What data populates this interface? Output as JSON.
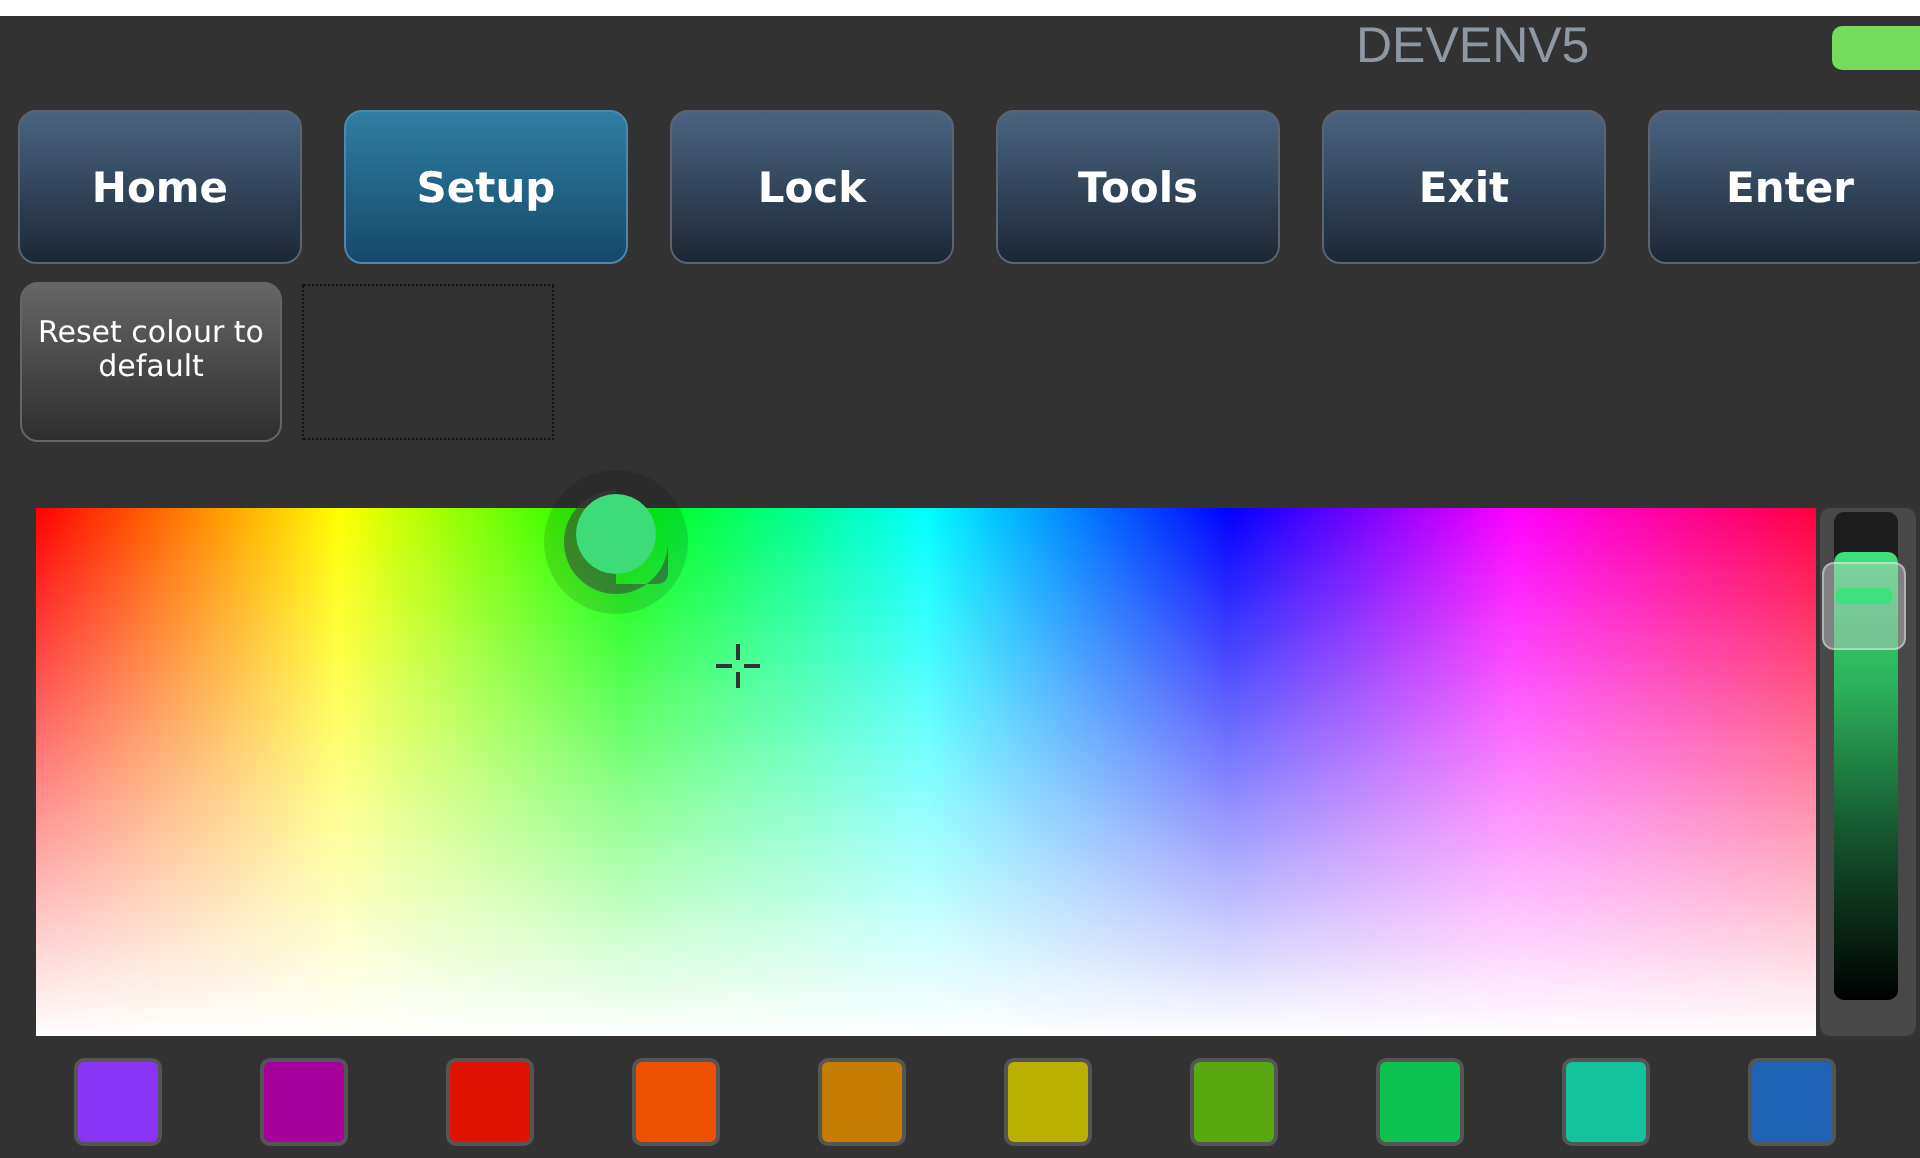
{
  "header": {
    "title": "DEVENV5",
    "status_on": true
  },
  "nav_buttons": [
    {
      "label": "Home",
      "selected": false
    },
    {
      "label": "Setup",
      "selected": true
    },
    {
      "label": "Lock",
      "selected": false
    },
    {
      "label": "Tools",
      "selected": false
    },
    {
      "label": "Exit",
      "selected": false
    },
    {
      "label": "Enter",
      "selected": false
    }
  ],
  "reset_button": {
    "label": "Reset colour to default"
  },
  "brightness_slider": {
    "level": 0.92
  },
  "swatches": [
    {
      "color": "#8a35f5"
    },
    {
      "color": "#a5009c"
    },
    {
      "color": "#e01200"
    },
    {
      "color": "#ec5000"
    },
    {
      "color": "#c47d00"
    },
    {
      "color": "#b9b000"
    },
    {
      "color": "#58a910"
    },
    {
      "color": "#0fc24f"
    },
    {
      "color": "#12c39b"
    },
    {
      "color": "#1e62b4"
    }
  ]
}
